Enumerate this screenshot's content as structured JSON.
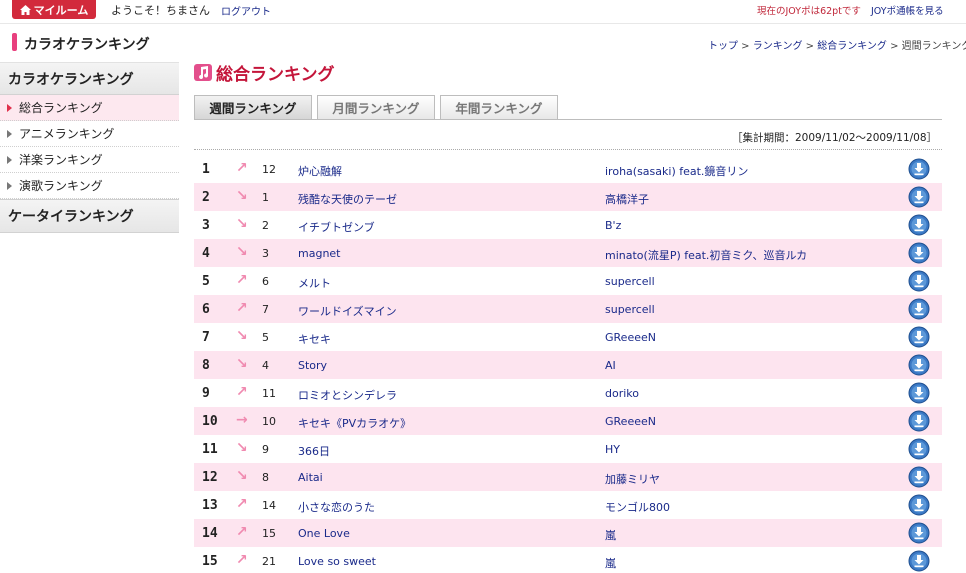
{
  "topbar": {
    "myroom_label": "マイルーム",
    "welcome": "ようこそ！ちまさん",
    "logout": "ログアウト",
    "points": "現在のJOYポは62ptです",
    "joy_link": "JOYポ通帳を見る"
  },
  "header": {
    "page_title": "カラオケランキング",
    "breadcrumb": [
      {
        "label": "トップ",
        "link": true
      },
      {
        "label": " > ",
        "link": false
      },
      {
        "label": "ランキング",
        "link": true
      },
      {
        "label": " > ",
        "link": false
      },
      {
        "label": "総合ランキング",
        "link": true
      },
      {
        "label": " > 週間ランキング",
        "link": false
      }
    ]
  },
  "sidebar": {
    "heading": "カラオケランキング",
    "items": [
      {
        "label": "総合ランキング",
        "active": true
      },
      {
        "label": "アニメランキング",
        "active": false
      },
      {
        "label": "洋楽ランキング",
        "active": false
      },
      {
        "label": "演歌ランキング",
        "active": false
      }
    ],
    "heading2": "ケータイランキング"
  },
  "main": {
    "title": "総合ランキング",
    "tabs": [
      {
        "label": "週間ランキング",
        "active": true
      },
      {
        "label": "月間ランキング",
        "active": false
      },
      {
        "label": "年間ランキング",
        "active": false
      }
    ],
    "period": "［集計期間：2009/11/02～2009/11/08］"
  },
  "ranking": [
    {
      "rank": "1",
      "trend": "up",
      "prev": "12",
      "song": "炉心融解",
      "artist": "iroha(sasaki) feat.鏡音リン"
    },
    {
      "rank": "2",
      "trend": "down",
      "prev": "1",
      "song": "残酷な天使のテーゼ",
      "artist": "高橋洋子"
    },
    {
      "rank": "3",
      "trend": "down",
      "prev": "2",
      "song": "イチブトゼンブ",
      "artist": "B'z"
    },
    {
      "rank": "4",
      "trend": "down",
      "prev": "3",
      "song": "magnet",
      "artist": "minato(流星P) feat.初音ミク、巡音ルカ"
    },
    {
      "rank": "5",
      "trend": "up",
      "prev": "6",
      "song": "メルト",
      "artist": "supercell"
    },
    {
      "rank": "6",
      "trend": "up",
      "prev": "7",
      "song": "ワールドイズマイン",
      "artist": "supercell"
    },
    {
      "rank": "7",
      "trend": "down",
      "prev": "5",
      "song": "キセキ",
      "artist": "GReeeeN"
    },
    {
      "rank": "8",
      "trend": "down",
      "prev": "4",
      "song": "Story",
      "artist": "AI"
    },
    {
      "rank": "9",
      "trend": "up",
      "prev": "11",
      "song": "ロミオとシンデレラ",
      "artist": "doriko"
    },
    {
      "rank": "10",
      "trend": "same",
      "prev": "10",
      "song": "キセキ《PVカラオケ》",
      "artist": "GReeeeN"
    },
    {
      "rank": "11",
      "trend": "down",
      "prev": "9",
      "song": "366日",
      "artist": "HY"
    },
    {
      "rank": "12",
      "trend": "down",
      "prev": "8",
      "song": "Aitai",
      "artist": "加藤ミリヤ"
    },
    {
      "rank": "13",
      "trend": "up",
      "prev": "14",
      "song": "小さな恋のうた",
      "artist": "モンゴル800"
    },
    {
      "rank": "14",
      "trend": "up",
      "prev": "15",
      "song": "One Love",
      "artist": "嵐"
    },
    {
      "rank": "15",
      "trend": "up",
      "prev": "21",
      "song": "Love so sweet",
      "artist": "嵐"
    }
  ],
  "colors": {
    "accent": "#c4153a",
    "myroom_button": "#d22a3c",
    "row_alt": "#fde4ef",
    "trend_arrow": "#f08ab0",
    "link": "#1a2a8a"
  },
  "icons": {
    "trend_up": "arrow-up-right-icon",
    "trend_down": "arrow-down-right-icon",
    "trend_same": "arrow-right-icon",
    "download": "download-icon"
  }
}
